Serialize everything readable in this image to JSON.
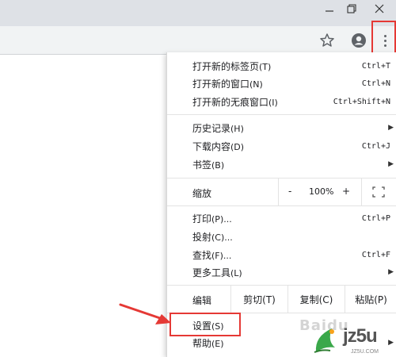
{
  "menu": {
    "new_tab": {
      "label": "打开新的标签页",
      "accel": "(T)",
      "shortcut": "Ctrl+T"
    },
    "new_window": {
      "label": "打开新的窗口",
      "accel": "(N)",
      "shortcut": "Ctrl+N"
    },
    "new_incognito": {
      "label": "打开新的无痕窗口",
      "accel": "(I)",
      "shortcut": "Ctrl+Shift+N"
    },
    "history": {
      "label": "历史记录",
      "accel": "(H)"
    },
    "downloads": {
      "label": "下载内容",
      "accel": "(D)",
      "shortcut": "Ctrl+J"
    },
    "bookmarks": {
      "label": "书签",
      "accel": "(B)"
    },
    "zoom": {
      "label": "缩放",
      "minus": "-",
      "value": "100%",
      "plus": "+"
    },
    "print": {
      "label": "打印",
      "accel": "(P)...",
      "shortcut": "Ctrl+P"
    },
    "cast": {
      "label": "投射",
      "accel": "(C)..."
    },
    "find": {
      "label": "查找",
      "accel": "(F)...",
      "shortcut": "Ctrl+F"
    },
    "more_tools": {
      "label": "更多工具",
      "accel": "(L)"
    },
    "edit": {
      "label": "编辑",
      "cut": "剪切(T)",
      "copy": "复制(C)",
      "paste": "粘贴(P)"
    },
    "settings": {
      "label": "设置",
      "accel": "(S)"
    },
    "help": {
      "label": "帮助",
      "accel": "(E)"
    }
  },
  "watermark": {
    "baidu": "Baidu",
    "site_logo": "jz5u",
    "site_url": "JZ5U.COM"
  },
  "colors": {
    "highlight": "#e53935",
    "titlebar": "#dee1e6",
    "toolbar": "#f1f3f4"
  }
}
